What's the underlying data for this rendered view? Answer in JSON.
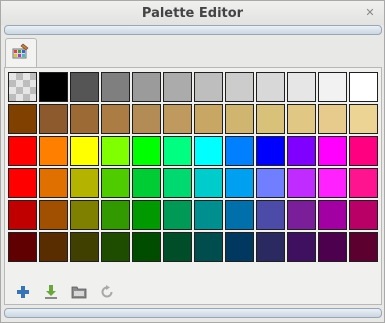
{
  "window": {
    "title": "Palette Editor",
    "close_glyph": "✕"
  },
  "tab": {
    "icon": "palette-icon"
  },
  "palette": [
    "transparent",
    "#000000",
    "#555555",
    "#7f7f7f",
    "#9b9b9b",
    "#ababab",
    "#bebebe",
    "#cccccc",
    "#d8d8d8",
    "#e6e6e6",
    "#f2f2f2",
    "#ffffff",
    "#804000",
    "#8c5a2d",
    "#9b6a35",
    "#ab7d45",
    "#b28b55",
    "#bf9a5e",
    "#c8a765",
    "#d0b571",
    "#d8c27a",
    "#e0c783",
    "#e6cb8c",
    "#ecd594",
    "#ff0000",
    "#ff8000",
    "#ffff00",
    "#80ff00",
    "#00ff00",
    "#00ff80",
    "#00ffff",
    "#0080ff",
    "#0000ff",
    "#8000ff",
    "#ff00ff",
    "#ff0080",
    "#ff0000",
    "#e07000",
    "#b3b300",
    "#4fcc00",
    "#00cc33",
    "#00d870",
    "#00cccc",
    "#00a0f0",
    "#6f7fff",
    "#c02bff",
    "#ff22ff",
    "#ff1490",
    "#c00000",
    "#a05000",
    "#7f7f00",
    "#339900",
    "#009900",
    "#009955",
    "#008f8f",
    "#006faa",
    "#4c4ca8",
    "#7a1f99",
    "#a300a3",
    "#b80066",
    "#600000",
    "#5a2d00",
    "#404000",
    "#1f4d00",
    "#004d00",
    "#004d2a",
    "#004d4d",
    "#003860",
    "#2a2a60",
    "#3f1060",
    "#4d004d",
    "#5c0030"
  ],
  "toolbar": [
    {
      "name": "add-color-button",
      "icon": "plus-icon"
    },
    {
      "name": "import-button",
      "icon": "download-icon"
    },
    {
      "name": "open-folder-button",
      "icon": "folder-icon"
    },
    {
      "name": "reset-button",
      "icon": "refresh-icon"
    }
  ],
  "colors": {
    "accent": "#3873b5"
  }
}
